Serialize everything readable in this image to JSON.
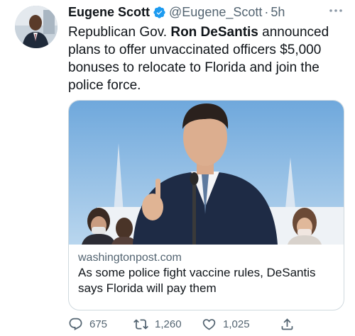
{
  "author": {
    "name": "Eugene Scott",
    "handle": "@Eugene_Scott",
    "separator": "·",
    "time": "5h",
    "verified_icon": "verified-badge-icon"
  },
  "tweet": {
    "text_part1": "Republican Gov. ",
    "text_bold": "Ron DeSantis",
    "text_part2": " announced plans to offer unvaccinated officers $5,000 bonuses to relocate to Florida and join the police force."
  },
  "card": {
    "domain": "washingtonpost.com",
    "title": "As some police fight vaccine rules, DeSantis says Florida will pay them"
  },
  "actions": {
    "replies": "675",
    "retweets": "1,260",
    "likes": "1,025"
  },
  "colors": {
    "text_primary": "#0f1419",
    "text_secondary": "#536471",
    "verified_blue": "#1d9bf0",
    "card_border": "#cfd9de"
  }
}
